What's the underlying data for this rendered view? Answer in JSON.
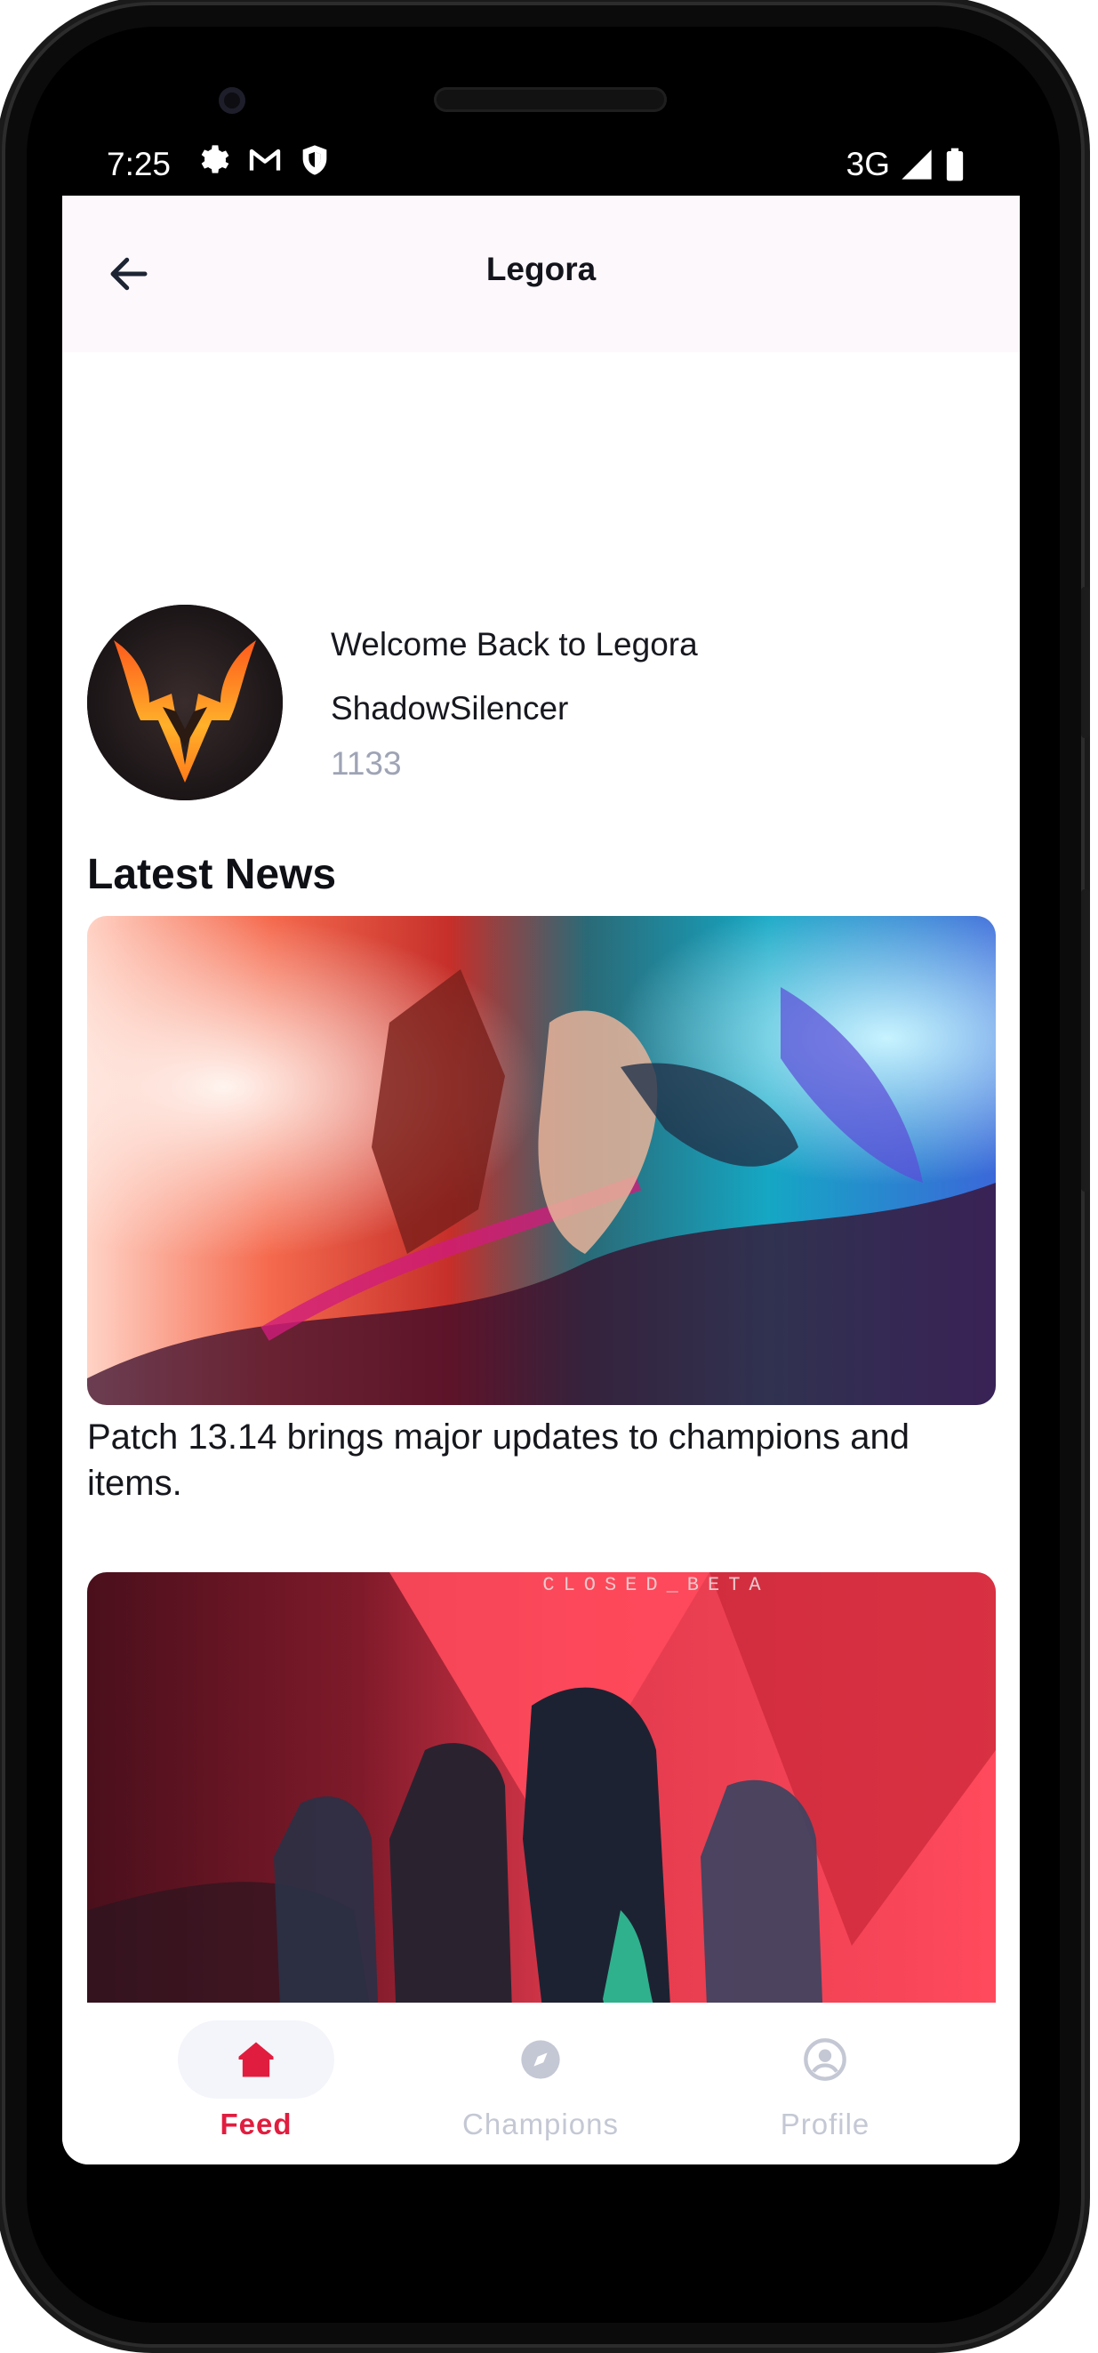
{
  "status_bar": {
    "time": "7:25",
    "network": "3G",
    "icons_left": [
      "gear-icon",
      "gmail-icon",
      "shield-icon"
    ],
    "icons_right": [
      "signal-icon",
      "battery-icon"
    ]
  },
  "appbar": {
    "title": "Legora",
    "back_icon": "arrow-left-icon"
  },
  "profile": {
    "welcome": "Welcome Back to Legora",
    "username": "ShadowSilencer",
    "score": "1133"
  },
  "news": {
    "section_title": "Latest News",
    "items": [
      {
        "caption": "Patch 13.14 brings major updates to champions and items."
      },
      {
        "caption": "",
        "banner_text": "CLOSED_BETA"
      }
    ]
  },
  "bottom_nav": {
    "items": [
      {
        "label": "Feed",
        "icon": "home-icon",
        "active": true
      },
      {
        "label": "Champions",
        "icon": "compass-icon",
        "active": false
      },
      {
        "label": "Profile",
        "icon": "user-circle-icon",
        "active": false
      }
    ]
  },
  "colors": {
    "accent": "#e11d3f",
    "inactive": "#c4c8d4",
    "appbar_bg": "#fdf8fc",
    "active_pill": "#f4f5fa"
  }
}
